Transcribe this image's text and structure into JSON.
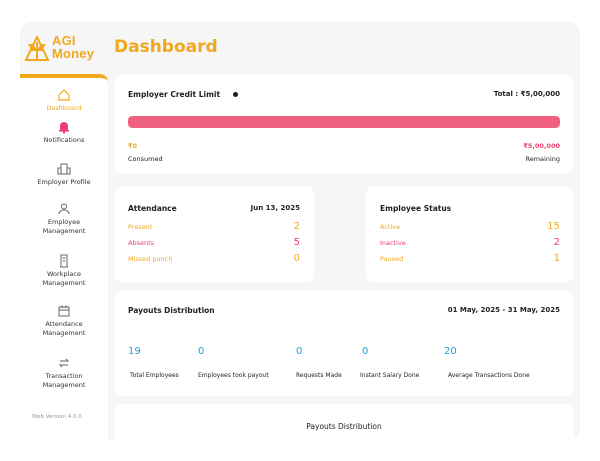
{
  "brand": {
    "line1": "AGI",
    "line2": "Money",
    "color": "#f2a81d"
  },
  "header": {
    "title": "Dashboard"
  },
  "sidebar": {
    "items": [
      {
        "label": "Dashboard",
        "icon": "home-icon",
        "active": true
      },
      {
        "label": "Notifications",
        "icon": "bell-icon"
      },
      {
        "label": "Employer Profile",
        "icon": "building-icon"
      },
      {
        "label": "Employee Management",
        "icon": "users-icon"
      },
      {
        "label": "Workplace Management",
        "icon": "office-icon"
      },
      {
        "label": "Attendance Management",
        "icon": "calendar-icon"
      },
      {
        "label": "Transaction Management",
        "icon": "exchange-icon"
      }
    ],
    "version": "Web Version 4.0.0"
  },
  "credit": {
    "title": "Employer Credit Limit",
    "total": "Total : ₹5,00,000",
    "consumed_value": "₹0",
    "consumed_label": "Consumed",
    "remaining_value": "₹5,00,000",
    "remaining_label": "Remaining",
    "remaining_fraction": 1.0,
    "colors": {
      "bar": "#f0607f",
      "consumed": "#f2a81d",
      "remaining": "#ec3f6e"
    }
  },
  "attendance": {
    "title": "Attendance",
    "date": "Jun 13, 2025",
    "rows": [
      {
        "label": "Present",
        "value": "2",
        "color": "#f2a81d"
      },
      {
        "label": "Absents",
        "value": "5",
        "color": "#ec3f6e"
      },
      {
        "label": "Missed punch",
        "value": "0",
        "color": "#f2a81d"
      }
    ]
  },
  "employee_status": {
    "title": "Employee Status",
    "rows": [
      {
        "label": "Active",
        "value": "15",
        "color": "#f2a81d"
      },
      {
        "label": "Inactive",
        "value": "2",
        "color": "#ec3f6e"
      },
      {
        "label": "Paused",
        "value": "1",
        "color": "#f2a81d"
      }
    ]
  },
  "payouts": {
    "title": "Payouts Distribution",
    "range": "01 May, 2025 - 31 May, 2025",
    "stats": [
      {
        "value": "19",
        "label": "Total Employees"
      },
      {
        "value": "0",
        "label": "Employees took payout"
      },
      {
        "value": "0",
        "label": "Requests Made"
      },
      {
        "value": "0",
        "label": "Instant Salary Done"
      },
      {
        "value": "20",
        "label": "Average Transactions Done"
      }
    ]
  },
  "distribution": {
    "title": "Payouts Distribution"
  }
}
